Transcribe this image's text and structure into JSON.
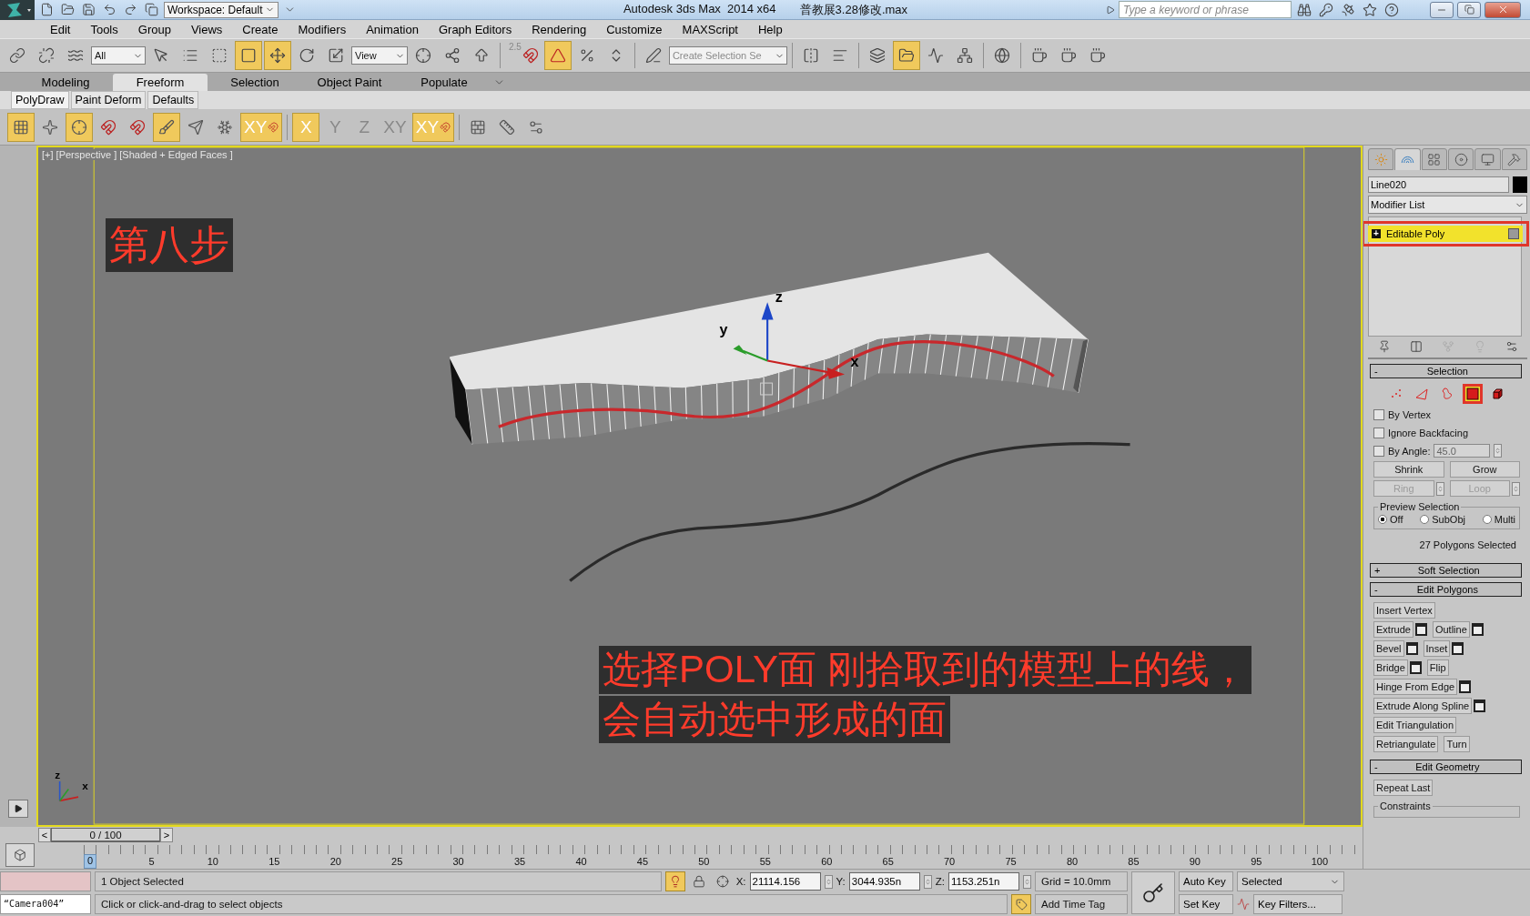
{
  "title_bar": {
    "workspace": "Workspace: Default",
    "app_title": "Autodesk 3ds Max  2014 x64",
    "file_name": "普教展3.28修改.max",
    "search_placeholder": "Type a keyword or phrase"
  },
  "menu": [
    "Edit",
    "Tools",
    "Group",
    "Views",
    "Create",
    "Modifiers",
    "Animation",
    "Graph Editors",
    "Rendering",
    "Customize",
    "MAXScript",
    "Help"
  ],
  "main_toolbar": {
    "selection_filter": "All",
    "reference_coordinate": "View",
    "named_selection_placeholder": "Create Selection Se",
    "buttons": [
      {
        "active": false
      },
      {
        "active": false
      },
      {
        "active": false
      },
      {
        "active": false
      },
      {
        "active": false
      },
      {
        "active": false
      },
      {
        "active": true
      },
      {
        "active": true
      },
      {
        "active": false
      },
      {
        "active": false
      },
      {
        "active": false
      },
      {
        "active": false
      },
      {
        "active": false
      },
      {
        "label": "2.5",
        "active": false
      },
      {
        "active": true
      },
      {
        "active": false
      },
      {
        "active": false
      },
      {
        "active": false
      },
      {
        "active": false
      },
      {
        "active": false
      },
      {
        "active": false
      },
      {
        "active": true
      },
      {
        "active": false
      },
      {
        "active": false
      },
      {
        "active": false
      },
      {
        "active": false
      },
      {
        "active": false
      },
      {
        "active": false
      }
    ]
  },
  "ribbon": {
    "tabs": [
      {
        "label": "Modeling",
        "selected": false
      },
      {
        "label": "Freeform",
        "selected": true
      },
      {
        "label": "Selection",
        "selected": false
      },
      {
        "label": "Object Paint",
        "selected": false
      },
      {
        "label": "Populate",
        "selected": false
      }
    ],
    "panels": [
      {
        "label": "PolyDraw",
        "selected": true
      },
      {
        "label": "Paint Deform",
        "selected": false
      },
      {
        "label": "Defaults",
        "selected": false
      }
    ],
    "tools": [
      {
        "active": true
      },
      {
        "active": false
      },
      {
        "active": true
      },
      {
        "active": false
      },
      {
        "active": false
      },
      {
        "active": true
      },
      {
        "active": false
      },
      {
        "active": false
      },
      {
        "label": "XY",
        "active": true
      },
      {
        "label": "X",
        "active": true
      },
      {
        "label": "Y",
        "active": false
      },
      {
        "label": "Z",
        "active": false
      },
      {
        "label": "XY",
        "active": false
      },
      {
        "label": "XY",
        "active": true
      },
      {
        "active": false
      },
      {
        "active": false
      },
      {
        "active": false
      }
    ]
  },
  "viewport": {
    "label": "[+] [Perspective ] [Shaded + Edged Faces ]",
    "step_note": "第八步",
    "instruction_lines": [
      "选择POLY面 刚拾取到的模型上的线，",
      "会自动选中形成的面"
    ],
    "gizmo_axes": [
      "z",
      "y",
      "x"
    ],
    "tripod_axes": [
      "z",
      "x"
    ]
  },
  "command_panel": {
    "tabs": [
      {
        "selected": false
      },
      {
        "selected": true
      },
      {
        "selected": false
      },
      {
        "selected": false
      },
      {
        "selected": false
      },
      {
        "selected": false
      }
    ],
    "object_name": "Line020",
    "modifier_list": "Modifier List",
    "stack": [
      {
        "label": "Editable Poly",
        "sign": "+",
        "selected": true
      }
    ],
    "selection": {
      "sign": "-",
      "title": "Selection",
      "levels": [
        {
          "selected": false
        },
        {
          "selected": false
        },
        {
          "selected": false
        },
        {
          "selected": true
        },
        {
          "selected": false
        }
      ],
      "options": [
        {
          "kind": "check",
          "label": "By Vertex",
          "checked": false
        },
        {
          "kind": "check",
          "label": "Ignore Backfacing",
          "checked": false
        },
        {
          "kind": "angle",
          "label": "By Angle:",
          "checked": false,
          "value": "45.0",
          "disabled": true
        }
      ],
      "buttons": [
        {
          "kind": "plain",
          "label": "Shrink",
          "disabled": false
        },
        {
          "kind": "plain",
          "label": "Grow",
          "disabled": false
        },
        {
          "kind": "spinner",
          "label": "Ring",
          "disabled": true
        },
        {
          "kind": "spinner",
          "label": "Loop",
          "disabled": true
        }
      ],
      "preview_title": "Preview Selection",
      "preview_options": [
        {
          "label": "Off",
          "selected": true
        },
        {
          "label": "SubObj",
          "selected": false
        },
        {
          "label": "Multi",
          "selected": false
        }
      ],
      "status": "27 Polygons Selected"
    },
    "rollouts": [
      {
        "sign": "+",
        "title": "Soft Selection"
      },
      {
        "sign": "-",
        "title": "Edit Polygons",
        "rows": [
          [
            {
              "label": "Insert Vertex",
              "settings": false
            }
          ],
          [
            {
              "label": "Extrude",
              "settings": true
            },
            {
              "label": "Outline",
              "settings": true
            }
          ],
          [
            {
              "label": "Bevel",
              "settings": true
            },
            {
              "label": "Inset",
              "settings": true
            }
          ],
          [
            {
              "label": "Bridge",
              "settings": true
            },
            {
              "label": "Flip",
              "settings": false
            }
          ],
          [
            {
              "label": "Hinge From Edge",
              "settings": true
            }
          ],
          [
            {
              "label": "Extrude Along Spline",
              "settings": true
            }
          ],
          [
            {
              "label": "Edit Triangulation",
              "settings": false
            }
          ],
          [
            {
              "label": "Retriangulate",
              "settings": false
            },
            {
              "label": "Turn",
              "settings": false
            }
          ]
        ]
      },
      {
        "sign": "-",
        "title": "Edit Geometry",
        "rows": [
          [
            {
              "label": "Repeat Last",
              "settings": false
            }
          ]
        ],
        "group": "Constraints"
      }
    ]
  },
  "time_slider": {
    "prev": "<",
    "label": "0 / 100",
    "next": ">",
    "level": 0
  },
  "ruler_ticks": [
    "0",
    "5",
    "10",
    "15",
    "20",
    "25",
    "30",
    "35",
    "40",
    "45",
    "50",
    "55",
    "60",
    "65",
    "70",
    "75",
    "80",
    "85",
    "90",
    "95",
    "100"
  ],
  "status_bar": {
    "listener_output": "“Camera004”",
    "selection_status": "1 Object Selected",
    "prompt": "Click or click-and-drag to select objects",
    "coordinates": [
      {
        "axis": "X:",
        "value": "21114.156"
      },
      {
        "axis": "Y:",
        "value": "3044.935n"
      },
      {
        "axis": "Z:",
        "value": "1153.251n"
      }
    ],
    "grid": "Grid = 10.0mm",
    "time_tag": "Add Time Tag",
    "auto_key": "Auto Key",
    "set_key": "Set Key",
    "key_mode": "Selected",
    "key_filters": "Key Filters..."
  }
}
